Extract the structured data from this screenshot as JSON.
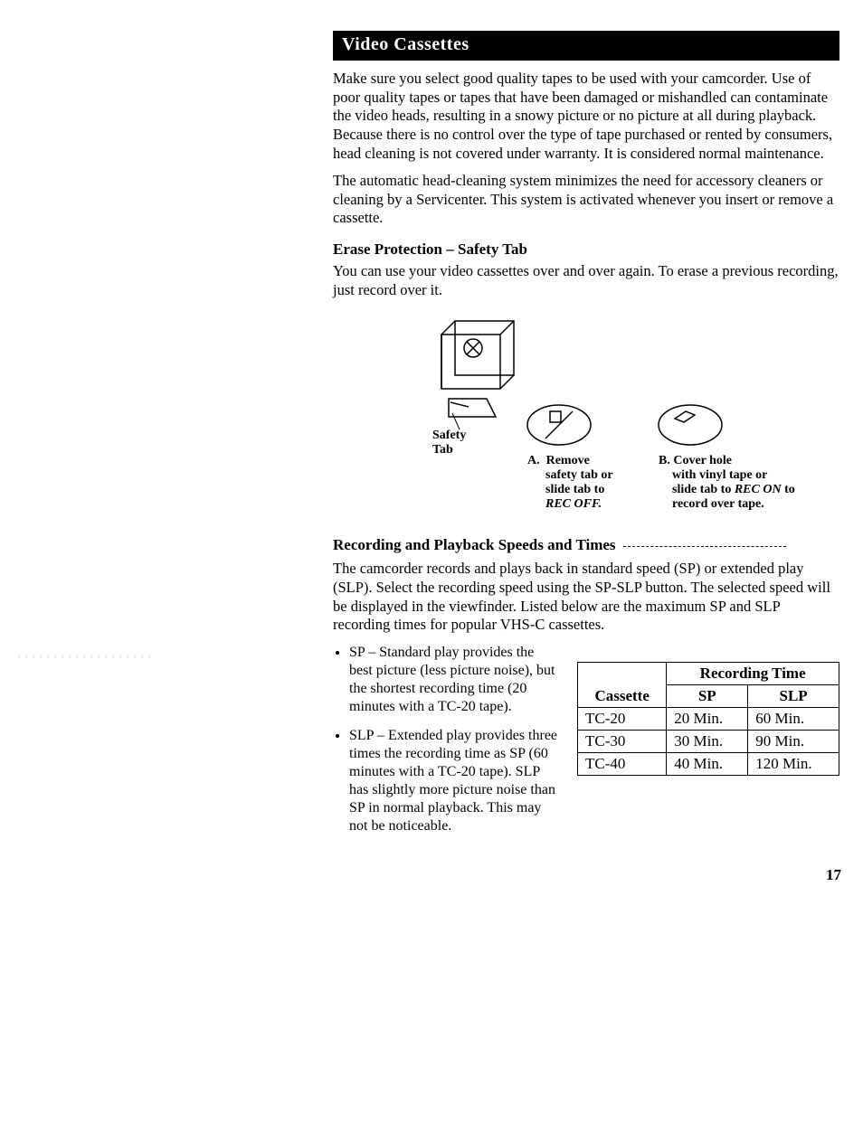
{
  "header": {
    "title": "Video Cassettes"
  },
  "intro": {
    "p1": "Make sure you select good quality tapes to be used with your camcorder. Use of poor quality tapes or tapes that have been damaged or mishandled can contaminate the video heads, resulting in a snowy picture or no picture at all during playback. Because there is no control over the type of tape purchased or rented by consumers, head cleaning is not covered under warranty. It is considered normal maintenance.",
    "p2": "The automatic head-cleaning system minimizes the need for accessory cleaners or cleaning by a Servicenter. This system is activated whenever you insert or remove a cassette."
  },
  "erase": {
    "heading": "Erase Protection – Safety Tab",
    "p": "You can use your video cassettes over and over again. To erase a previous recording, just record over it."
  },
  "diagram": {
    "safety_tab_label": "Safety Tab",
    "a_prefix": "A.",
    "a_bold1": "Remove",
    "a_line2": "safety tab or",
    "a_line3": "slide tab to",
    "a_ital": "REC OFF.",
    "b_prefix": "B.",
    "b_bold1": "Cover hole",
    "b_line2": "with vinyl tape or",
    "b_line3a": "slide tab to ",
    "b_ital": "REC ON",
    "b_line3b": " to",
    "b_line4": "record over tape."
  },
  "speeds": {
    "heading": "Recording and Playback Speeds and Times",
    "p": "The camcorder records and plays back in standard speed (SP) or extended play (SLP). Select the recording speed using the SP-SLP button. The selected speed will be displayed in the viewfinder. Listed below are the maximum SP and SLP recording times for popular VHS-C cassettes.",
    "bullets": [
      "SP – Standard play provides the best picture (less picture noise), but the shortest recording time (20 minutes with a TC-20 tape).",
      "SLP – Extended play provides three times the recording time as SP (60 minutes with a TC-20 tape). SLP has slightly more picture noise than SP in normal playback. This may not be noticeable."
    ]
  },
  "table": {
    "col_cassette": "Cassette",
    "col_rectime": "Recording Time",
    "col_sp": "SP",
    "col_slp": "SLP",
    "rows": [
      {
        "cassette": "TC-20",
        "sp": "20 Min.",
        "slp": "60 Min."
      },
      {
        "cassette": "TC-30",
        "sp": "30 Min.",
        "slp": "90 Min."
      },
      {
        "cassette": "TC-40",
        "sp": "40 Min.",
        "slp": "120 Min."
      }
    ]
  },
  "page_number": "17"
}
